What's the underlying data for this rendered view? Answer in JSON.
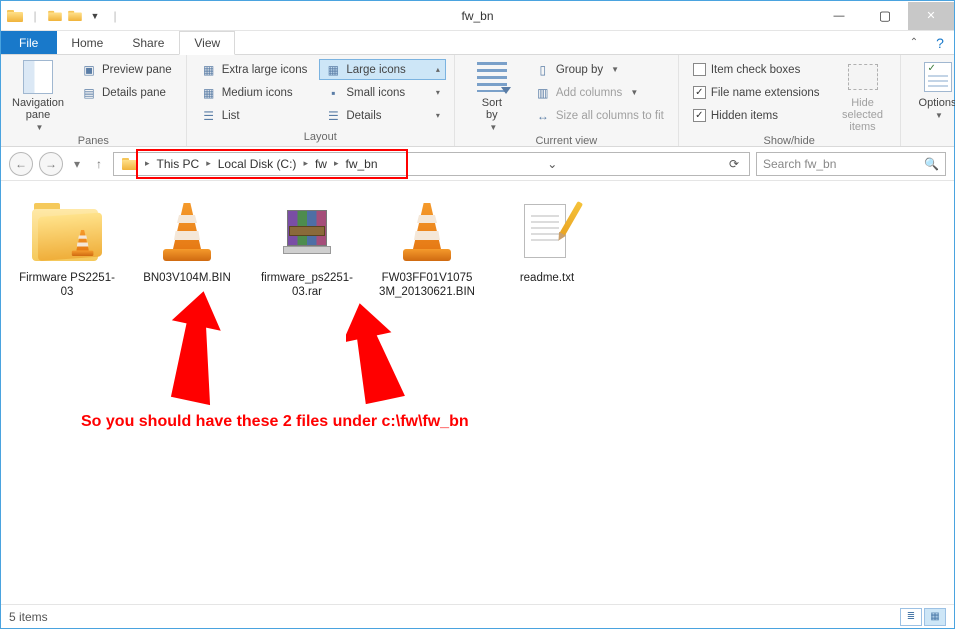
{
  "window": {
    "title": "fw_bn"
  },
  "tabs": {
    "file": "File",
    "home": "Home",
    "share": "Share",
    "view": "View"
  },
  "ribbon": {
    "panes": {
      "nav": "Navigation\npane",
      "preview": "Preview pane",
      "details": "Details pane",
      "label": "Panes"
    },
    "layout": {
      "xl": "Extra large icons",
      "lg": "Large icons",
      "md": "Medium icons",
      "sm": "Small icons",
      "list": "List",
      "det": "Details",
      "label": "Layout"
    },
    "current": {
      "sort": "Sort\nby",
      "group": "Group by",
      "addcols": "Add columns",
      "sizecols": "Size all columns to fit",
      "label": "Current view"
    },
    "showhide": {
      "itemcheck": "Item check boxes",
      "ext": "File name extensions",
      "hidden": "Hidden items",
      "hidesel": "Hide selected\nitems",
      "label": "Show/hide"
    },
    "options": "Options"
  },
  "breadcrumb": [
    "This PC",
    "Local Disk (C:)",
    "fw",
    "fw_bn"
  ],
  "search_placeholder": "Search fw_bn",
  "files": [
    {
      "name": "Firmware PS2251-03"
    },
    {
      "name": "BN03V104M.BIN"
    },
    {
      "name": "firmware_ps2251-03.rar"
    },
    {
      "name": "FW03FF01V10753M_20130621.BIN"
    },
    {
      "name": "readme.txt"
    }
  ],
  "annotation": "So you should have these 2 files under c:\\fw\\fw_bn",
  "status": {
    "count": "5 items"
  }
}
